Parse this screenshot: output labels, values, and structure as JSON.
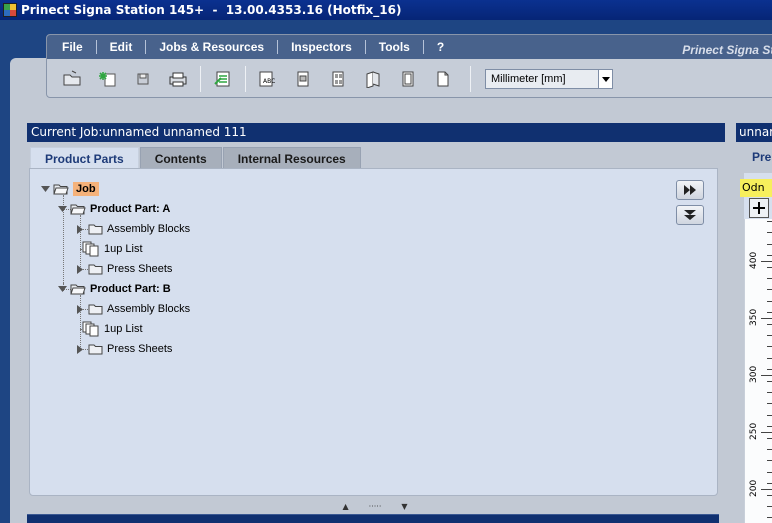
{
  "window": {
    "title": "Prinect Signa Station 145+  -  13.00.4353.16 (Hotfix_16)"
  },
  "menu": {
    "items": [
      "File",
      "Edit",
      "Jobs & Resources",
      "Inspectors",
      "Tools",
      "?"
    ],
    "brand": "Prinect Signa Stat"
  },
  "toolbar": {
    "unit_value": "Millimeter  [mm]"
  },
  "job_panel": {
    "header": "Current Job:unnamed unnamed 111",
    "tabs": [
      "Product Parts",
      "Contents",
      "Internal Resources"
    ],
    "active_tab": "Product Parts",
    "tree": {
      "job": "Job",
      "parts": [
        {
          "label": "Product Part: A",
          "children": [
            "Assembly Blocks",
            "1up List",
            "Press Sheets"
          ]
        },
        {
          "label": "Product Part: B",
          "children": [
            "Assembly Blocks",
            "1up List",
            "Press Sheets"
          ]
        }
      ]
    }
  },
  "right_panel": {
    "header": "unnar",
    "tab": "Pre",
    "label": "Odn",
    "ruler_marks": [
      "400",
      "350",
      "300",
      "250",
      "200"
    ]
  },
  "colors": {
    "accent_dark": "#103070",
    "job_highlight": "#f5b27a",
    "label_yellow": "#f7ef5c"
  }
}
